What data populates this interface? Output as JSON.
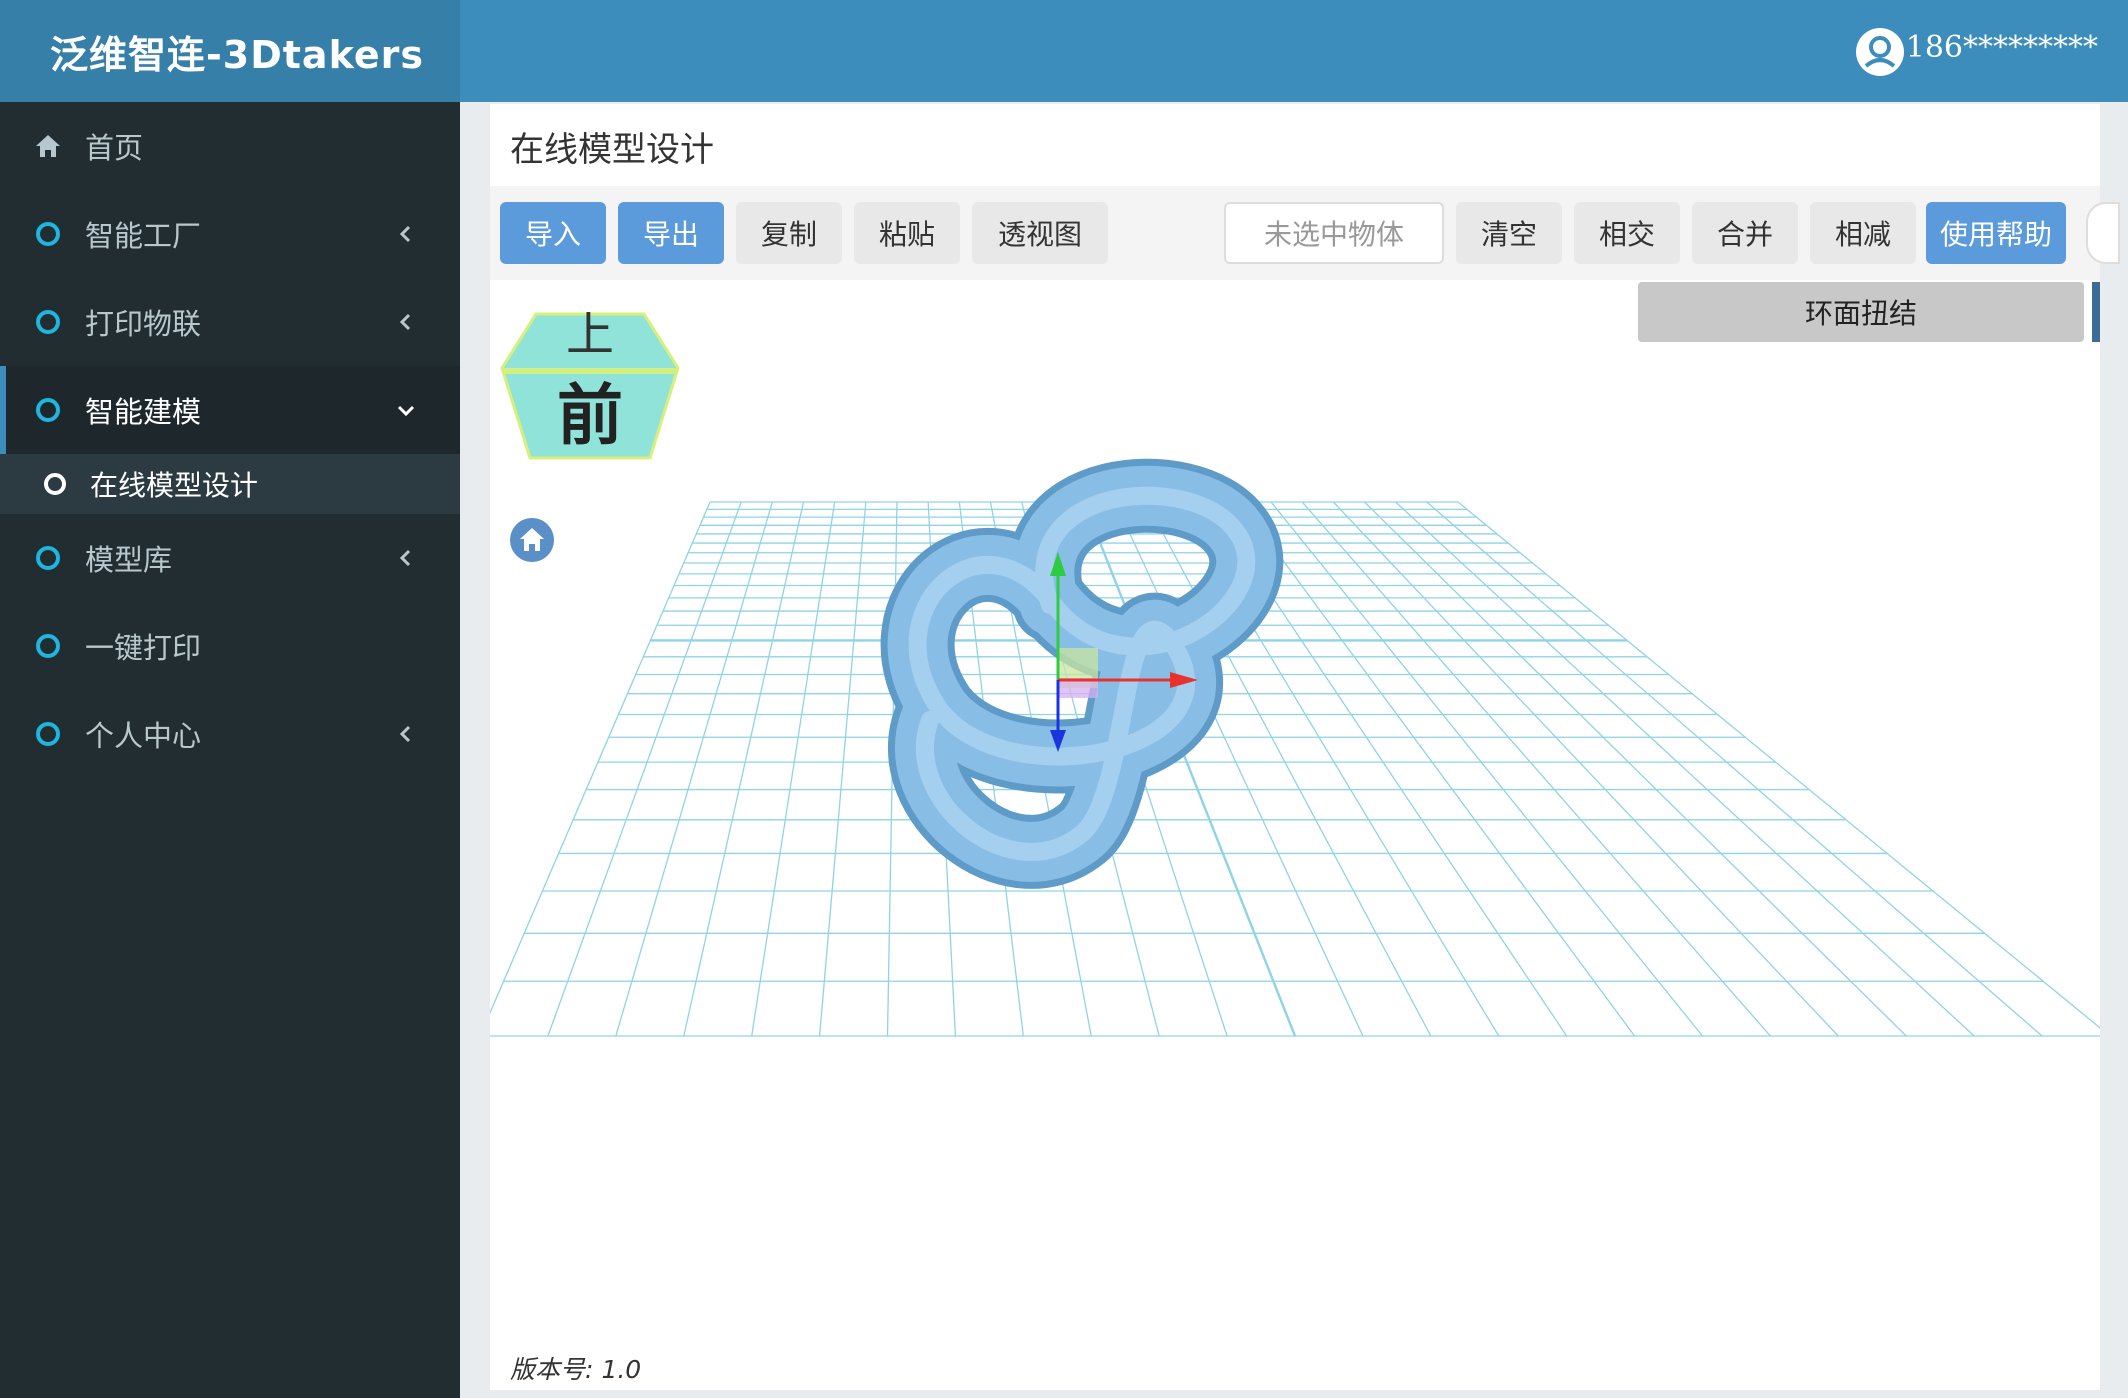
{
  "header": {
    "brand": "泛维智连-3Dtakers",
    "user_phone": "186*********",
    "colors": {
      "brand_bg": "#367fa9",
      "topbar_bg": "#3c8dbc"
    }
  },
  "sidebar": {
    "items": [
      {
        "label": "首页",
        "icon": "home-icon",
        "has_chevron": false
      },
      {
        "label": "智能工厂",
        "icon": "circle-icon",
        "has_chevron": true
      },
      {
        "label": "打印物联",
        "icon": "circle-icon",
        "has_chevron": true
      },
      {
        "label": "智能建模",
        "icon": "circle-icon",
        "has_chevron": true,
        "active": true
      },
      {
        "label": "模型库",
        "icon": "circle-icon",
        "has_chevron": true
      },
      {
        "label": "一键打印",
        "icon": "circle-icon",
        "has_chevron": false
      },
      {
        "label": "个人中心",
        "icon": "circle-icon",
        "has_chevron": true
      }
    ],
    "sub_item": "在线模型设计"
  },
  "main": {
    "page_title": "在线模型设计",
    "toolbar": {
      "import": "导入",
      "export": "导出",
      "copy": "复制",
      "paste": "粘贴",
      "perspective": "透视图",
      "selection_status": "未选中物体",
      "clear": "清空",
      "intersect": "相交",
      "merge": "合并",
      "subtract": "相减",
      "help": "使用帮助"
    },
    "viewport": {
      "preset_shape": "环面扭结",
      "view_cube": {
        "top": "上",
        "front": "前"
      },
      "version_label": "版本号:",
      "version_value": "1.0",
      "colors": {
        "grid": "#8fd3e6",
        "model": "#88bde6"
      }
    }
  }
}
